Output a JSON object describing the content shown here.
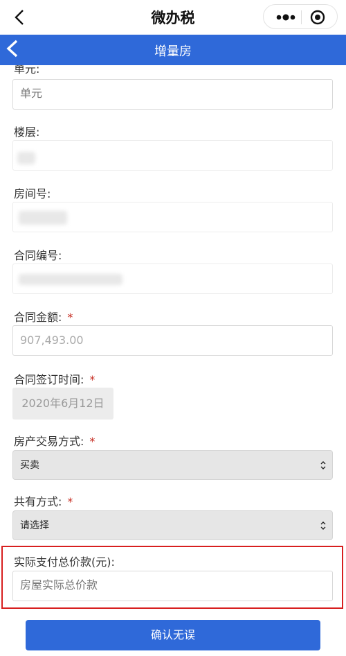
{
  "miniprogram": {
    "title": "微办税"
  },
  "header": {
    "title": "增量房"
  },
  "form": {
    "unit": {
      "label": "单元:",
      "placeholder": "单元"
    },
    "floor": {
      "label": "楼层:"
    },
    "room": {
      "label": "房间号:"
    },
    "contract_no": {
      "label": "合同编号:"
    },
    "contract_amount": {
      "label": "合同金额:",
      "required": "*",
      "value": "907,493.00"
    },
    "sign_date": {
      "label": "合同签订时间:",
      "required": "*",
      "value": "2020年6月12日"
    },
    "trade_method": {
      "label": "房产交易方式:",
      "required": "*",
      "selected": "买卖"
    },
    "shared_method": {
      "label": "共有方式:",
      "required": "*",
      "selected": "请选择"
    },
    "actual_total": {
      "label": "实际支付总价款(元):",
      "placeholder": "房屋实际总价款"
    }
  },
  "confirm_button": "确认无误",
  "colors": {
    "brand_blue": "#2f69d9",
    "highlight_red": "#d71f1f",
    "required_red": "#c62d22"
  }
}
